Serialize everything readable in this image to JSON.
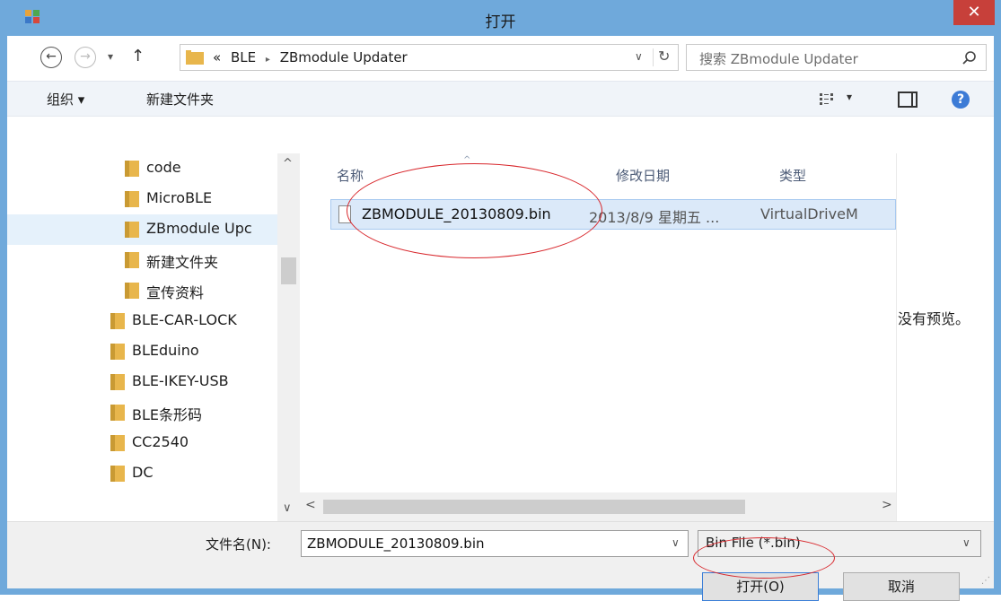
{
  "window": {
    "title": "打开",
    "close_glyph": "✕"
  },
  "nav": {
    "back_glyph": "←",
    "forward_glyph": "→",
    "recent_glyph": "▾",
    "up_glyph": "↑",
    "breadcrumb_overflow": "«",
    "breadcrumb": [
      "BLE",
      "ZBmodule Updater"
    ],
    "crumb_sep": "▸",
    "dropdown_glyph": "∨",
    "refresh_glyph": "↻"
  },
  "search": {
    "placeholder": "搜索 ZBmodule Updater"
  },
  "toolbar": {
    "organize": "组织 ▾",
    "new_folder": "新建文件夹",
    "view_dropdown": "▾"
  },
  "tree": [
    {
      "label": "code",
      "indent": 1
    },
    {
      "label": "MicroBLE",
      "indent": 1
    },
    {
      "label": "ZBmodule Upc",
      "indent": 1,
      "selected": true
    },
    {
      "label": "新建文件夹",
      "indent": 1
    },
    {
      "label": "宣传资料",
      "indent": 1
    },
    {
      "label": "BLE-CAR-LOCK",
      "indent": 0
    },
    {
      "label": "BLEduino",
      "indent": 0
    },
    {
      "label": "BLE-IKEY-USB",
      "indent": 0
    },
    {
      "label": "BLE条形码",
      "indent": 0
    },
    {
      "label": "CC2540",
      "indent": 0
    },
    {
      "label": "DC",
      "indent": 0
    }
  ],
  "scroll": {
    "up": "^",
    "down": "∨",
    "left": "<",
    "right": ">"
  },
  "columns": {
    "name": "名称",
    "modified": "修改日期",
    "type": "类型",
    "sort_glyph": "^"
  },
  "files": [
    {
      "name": "ZBMODULE_20130809.bin",
      "modified": "2013/8/9 星期五 ...",
      "type": "VirtualDriveM"
    }
  ],
  "preview": {
    "empty_text": "没有预览。"
  },
  "bottom": {
    "filename_label": "文件名(N):",
    "filename_value": "ZBMODULE_20130809.bin",
    "filter_value": "Bin File (*.bin)",
    "open_button": "打开(O)",
    "cancel_button": "取消",
    "dropdown_glyph": "∨",
    "grip_glyph": "⋰"
  },
  "colors": {
    "titlebar": "#6fa9db",
    "close": "#c7403a",
    "folder": "#e8b64c",
    "annotation": "#d8272c",
    "selection": "#dbe9f9"
  }
}
